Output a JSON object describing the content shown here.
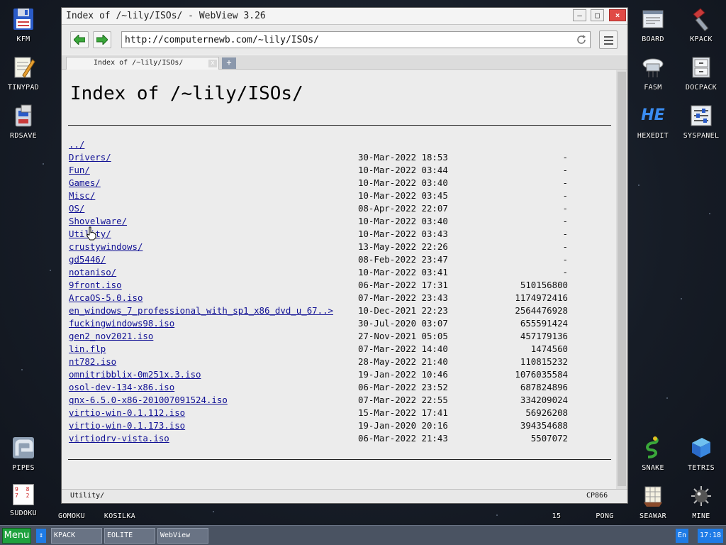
{
  "window": {
    "title": "Index of /~lily/ISOs/ - WebView 3.26",
    "url": "http://computernewb.com/~lily/ISOs/",
    "tab_title": "Index of /~lily/ISOs/",
    "tab_close": "x",
    "new_tab": "+",
    "status_text": "Utility/",
    "encoding": "CP866"
  },
  "page": {
    "heading": "Index of /~lily/ISOs/",
    "entries": [
      {
        "name": "../",
        "date": "",
        "size": ""
      },
      {
        "name": "Drivers/",
        "date": "30-Mar-2022 18:53",
        "size": "-"
      },
      {
        "name": "Fun/",
        "date": "10-Mar-2022 03:44",
        "size": "-"
      },
      {
        "name": "Games/",
        "date": "10-Mar-2022 03:40",
        "size": "-"
      },
      {
        "name": "Misc/",
        "date": "10-Mar-2022 03:45",
        "size": "-"
      },
      {
        "name": "OS/",
        "date": "08-Apr-2022 22:07",
        "size": "-"
      },
      {
        "name": "Shovelware/",
        "date": "10-Mar-2022 03:40",
        "size": "-"
      },
      {
        "name": "Utility/",
        "date": "10-Mar-2022 03:43",
        "size": "-"
      },
      {
        "name": "crustywindows/",
        "date": "13-May-2022 22:26",
        "size": "-"
      },
      {
        "name": "gd5446/",
        "date": "08-Feb-2022 23:47",
        "size": "-"
      },
      {
        "name": "notaniso/",
        "date": "10-Mar-2022 03:41",
        "size": "-"
      },
      {
        "name": "9front.iso",
        "date": "06-Mar-2022 17:31",
        "size": "510156800"
      },
      {
        "name": "ArcaOS-5.0.iso",
        "date": "07-Mar-2022 23:43",
        "size": "1174972416"
      },
      {
        "name": "en_windows_7_professional_with_sp1_x86_dvd_u_67..>",
        "date": "10-Dec-2021 22:23",
        "size": "2564476928"
      },
      {
        "name": "fuckingwindows98.iso",
        "date": "30-Jul-2020 03:07",
        "size": "655591424"
      },
      {
        "name": "gen2_nov2021.iso",
        "date": "27-Nov-2021 05:05",
        "size": "457179136"
      },
      {
        "name": "lin.flp",
        "date": "07-Mar-2022 14:40",
        "size": "1474560"
      },
      {
        "name": "nt782.iso",
        "date": "28-May-2022 21:40",
        "size": "110815232"
      },
      {
        "name": "omnitribblix-0m251x.3.iso",
        "date": "19-Jan-2022 10:46",
        "size": "1076035584"
      },
      {
        "name": "osol-dev-134-x86.iso",
        "date": "06-Mar-2022 23:52",
        "size": "687824896"
      },
      {
        "name": "qnx-6.5.0-x86-201007091524.iso",
        "date": "07-Mar-2022 22:55",
        "size": "334209024"
      },
      {
        "name": "virtio-win-0.1.112.iso",
        "date": "15-Mar-2022 17:41",
        "size": "56926208"
      },
      {
        "name": "virtio-win-0.1.173.iso",
        "date": "19-Jan-2020 20:16",
        "size": "394354688"
      },
      {
        "name": "virtiodrv-vista.iso",
        "date": "06-Mar-2022 21:43",
        "size": "5507072"
      }
    ]
  },
  "desktop_icons": {
    "kfm": "KFM",
    "tinypad": "TINYPAD",
    "rdsave": "RDSAVE",
    "pipes": "PIPES",
    "sudoku": "SUDOKU",
    "gomoku": "GOMOKU",
    "kosilka": "KOSILKA",
    "board": "BOARD",
    "kpack": "KPACK",
    "fasm": "FASM",
    "docpack": "DOCPACK",
    "hexedit": "HEXEDIT",
    "syspanel": "SYSPANEL",
    "snake": "SNAKE",
    "tetris": "TETRIS",
    "seawar": "SEAWAR",
    "mine": "MINE",
    "pong": "PONG",
    "fifteen": "15",
    "hexedit_glyph": "HE",
    "sudoku_digits": "9 8 7 2"
  },
  "taskbar": {
    "menu_label": "Menu",
    "swap_glyph": "↕",
    "tasks": [
      "KPACK",
      "EOLITE",
      "WebView"
    ],
    "lang": "En",
    "clock": "17:18"
  },
  "colors": {
    "link": "#101094",
    "menu_button": "#1ea23e",
    "accent_blue": "#1e7be6",
    "close_button": "#e04a46"
  }
}
